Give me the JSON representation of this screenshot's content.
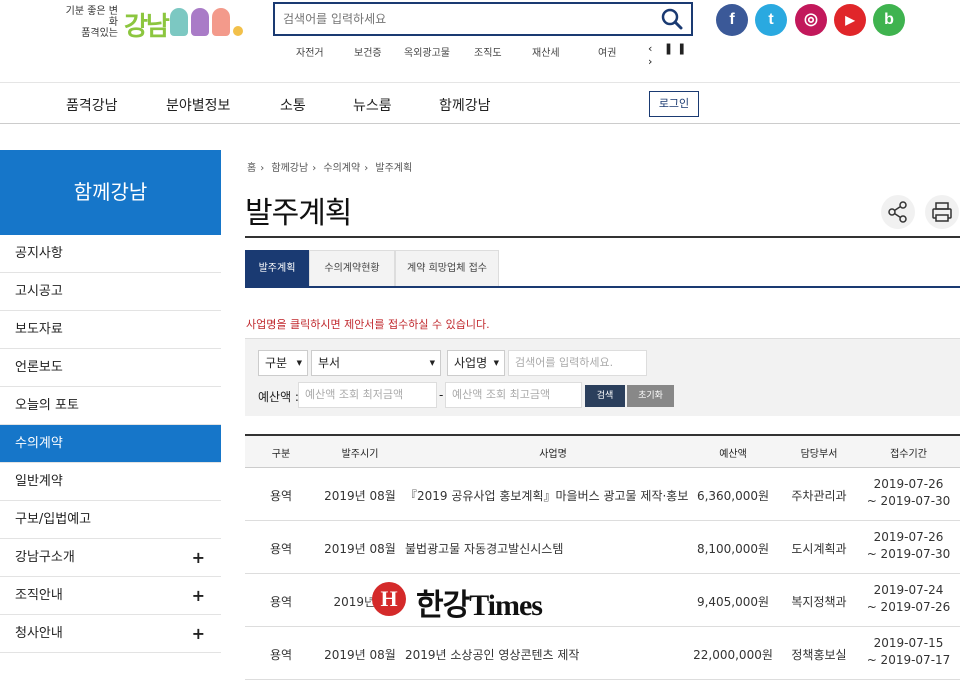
{
  "header": {
    "logo_slogan_line1": "기분 좋은 변화",
    "logo_slogan_line2": "품격있는",
    "logo_name": "강남",
    "search_placeholder": "검색어를 입력하세요",
    "keywords": [
      "자전거",
      "보건증",
      "옥외광고물",
      "조직도",
      "재산세",
      "여권"
    ],
    "keyword_controls": "‹ ❚❚ ›",
    "sns": [
      {
        "name": "facebook-icon",
        "glyph": "f",
        "color": "#3b5998"
      },
      {
        "name": "twitter-icon",
        "glyph": "t",
        "color": "#2aa9e0"
      },
      {
        "name": "instagram-icon",
        "glyph": "◎",
        "color": "#c2185b"
      },
      {
        "name": "youtube-icon",
        "glyph": "▶",
        "color": "#e0262a"
      },
      {
        "name": "blog-icon",
        "glyph": "b",
        "color": "#3fb34f"
      }
    ]
  },
  "gnb": {
    "items": [
      "품격강남",
      "분야별정보",
      "소통",
      "뉴스룸",
      "함께강남"
    ],
    "login": "로그인"
  },
  "sidebar": {
    "title": "함께강남",
    "items": [
      {
        "label": "공지사항",
        "plus": ""
      },
      {
        "label": "고시공고",
        "plus": ""
      },
      {
        "label": "보도자료",
        "plus": ""
      },
      {
        "label": "언론보도",
        "plus": ""
      },
      {
        "label": "오늘의 포토",
        "plus": ""
      },
      {
        "label": "수의계약",
        "plus": "",
        "active": true
      },
      {
        "label": "일반계약",
        "plus": ""
      },
      {
        "label": "구보/입법예고",
        "plus": ""
      },
      {
        "label": "강남구소개",
        "plus": "+"
      },
      {
        "label": "조직안내",
        "plus": "+"
      },
      {
        "label": "청사안내",
        "plus": "+"
      }
    ]
  },
  "breadcrumb": [
    "홈",
    "함께강남",
    "수의계약",
    "발주계획"
  ],
  "page_title": "발주계획",
  "tabs": [
    "발주계획",
    "수의계약현황",
    "계약 희망업체 접수"
  ],
  "notice": "사업명을 클릭하시면 제안서를 접수하실 수 있습니다.",
  "filter": {
    "type_select": "구분",
    "dept_select": "부서",
    "field_select": "사업명",
    "keyword_placeholder": "검색어를 입력하세요.",
    "budget_label": "예산액 :",
    "min_placeholder": "예산액 조회 최저금액",
    "dash": "-",
    "max_placeholder": "예산액 조회 최고금액",
    "search_btn": "검색",
    "reset_btn": "초기화"
  },
  "table": {
    "headers": [
      "구분",
      "발주시기",
      "사업명",
      "예산액",
      "담당부서",
      "접수기간"
    ],
    "rows": [
      {
        "type": "용역",
        "when": "2019년 08월",
        "title": "『2019 공유사업 홍보계획』마을버스 광고물 제작·홍보",
        "budget": "6,360,000원",
        "dept": "주차관리과",
        "from": "2019-07-26",
        "to": "~ 2019-07-30"
      },
      {
        "type": "용역",
        "when": "2019년 08월",
        "title": "불법광고물 자동경고발신시스템",
        "budget": "8,100,000원",
        "dept": "도시계획과",
        "from": "2019-07-26",
        "to": "~ 2019-07-30"
      },
      {
        "type": "용역",
        "when": "2019년 0",
        "title": "",
        "budget": "9,405,000원",
        "dept": "복지정책과",
        "from": "2019-07-24",
        "to": "~ 2019-07-26"
      },
      {
        "type": "용역",
        "when": "2019년 08월",
        "title": "2019년 소상공인 영상콘텐츠 제작",
        "budget": "22,000,000원",
        "dept": "정책홍보실",
        "from": "2019-07-15",
        "to": "~ 2019-07-17"
      }
    ]
  },
  "watermark": {
    "mark": "H",
    "text": "한강Times"
  }
}
